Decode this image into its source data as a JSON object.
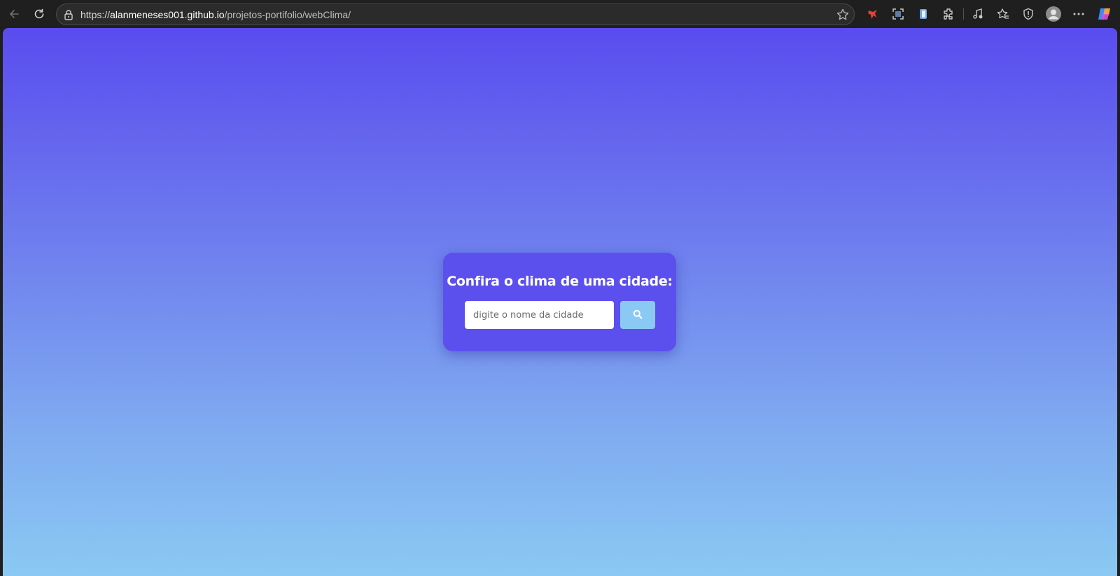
{
  "browser": {
    "url_scheme": "https://",
    "url_domain": "alanmeneses001.github.io",
    "url_path": "/projetos-portifolio/webClima/",
    "icons": [
      "back-icon",
      "reload-icon",
      "lock-icon",
      "favorite-star-icon",
      "extension-red-icon",
      "screenshot-icon",
      "phone-icon",
      "extensions-icon",
      "media-icon",
      "favorites-icon",
      "shield-icon",
      "profile-icon",
      "more-icon",
      "copilot-icon"
    ]
  },
  "page": {
    "title": "Confira o clima de uma cidade:",
    "search_placeholder": "digite o nome da cidade",
    "search_value": "",
    "colors": {
      "gradient_top": "#5a4cef",
      "gradient_bottom": "#8ac9f3",
      "card": "#5b50ee",
      "button": "#8ac9f3"
    }
  }
}
